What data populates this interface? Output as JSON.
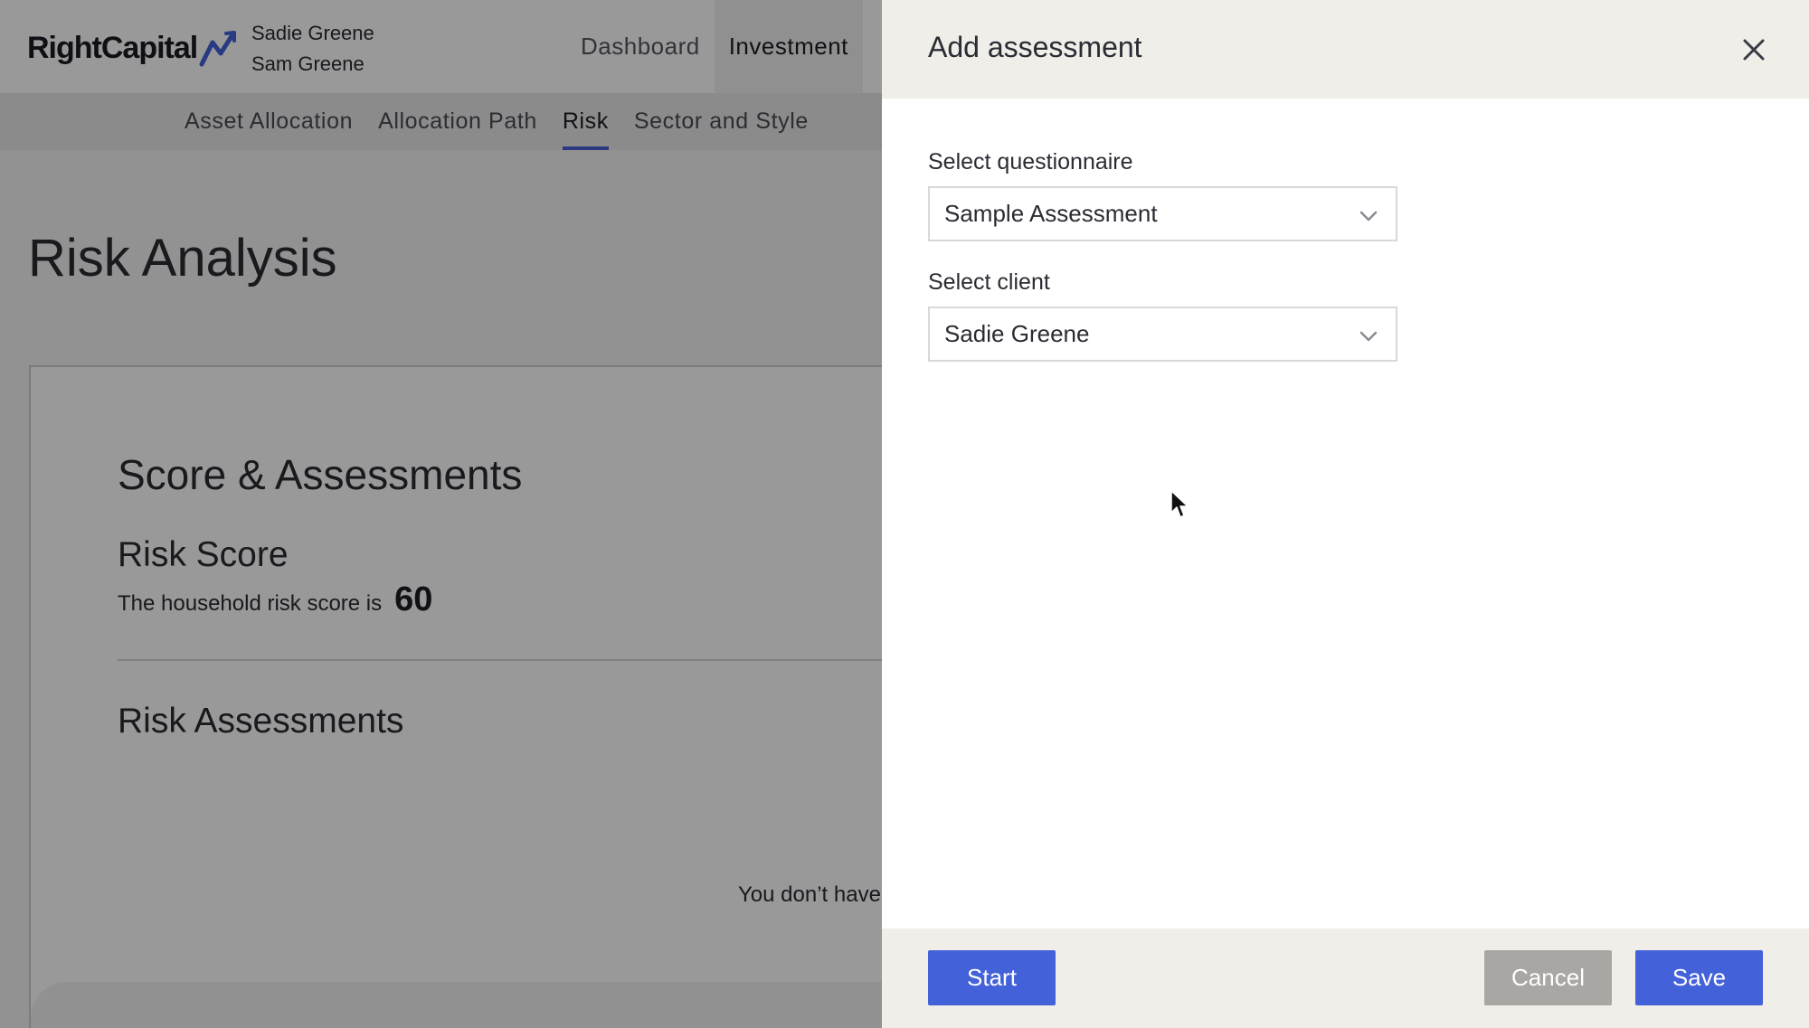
{
  "app": {
    "logo_text": "RightCapital",
    "clients": [
      "Sadie Greene",
      "Sam Greene"
    ],
    "nav": [
      {
        "label": "Dashboard",
        "active": false
      },
      {
        "label": "Investment",
        "active": true
      }
    ],
    "subnav": [
      {
        "label": "Asset Allocation",
        "active": false
      },
      {
        "label": "Allocation Path",
        "active": false
      },
      {
        "label": "Risk",
        "active": true
      },
      {
        "label": "Sector and Style",
        "active": false
      }
    ],
    "page_title": "Risk Analysis",
    "card": {
      "title": "Score & Assessments",
      "risk_score_heading": "Risk Score",
      "risk_score_label": "The household risk score is",
      "risk_score_value": "60",
      "assessments_heading": "Risk Assessments",
      "empty_message": "You don’t have"
    }
  },
  "drawer": {
    "title": "Add assessment",
    "questionnaire_label": "Select questionnaire",
    "questionnaire_value": "Sample Assessment",
    "client_label": "Select client",
    "client_value": "Sadie Greene",
    "start_label": "Start",
    "cancel_label": "Cancel",
    "save_label": "Save"
  },
  "colors": {
    "accent": "#4361d8",
    "cancel": "#a9a7a3",
    "drawer_chrome": "#efeee9"
  }
}
